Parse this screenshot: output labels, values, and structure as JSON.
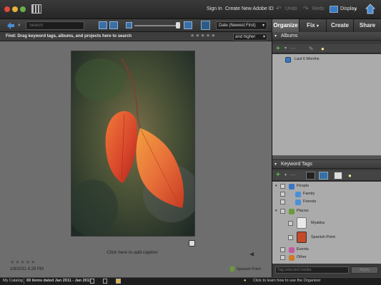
{
  "titlebar": {
    "sign_in": "Sign In",
    "create_id": "Create New Adobe ID",
    "undo": "Undo",
    "redo": "Redo",
    "display": "Display"
  },
  "tabs": [
    {
      "label": "Organize",
      "active": true
    },
    {
      "label": "Fix"
    },
    {
      "label": "Create"
    },
    {
      "label": "Share"
    }
  ],
  "toolbar": {
    "search_placeholder": "Search",
    "sort": "Date (Newest First)"
  },
  "findbar": {
    "text": "Find: Drag keyword tags, albums, and projects here to search",
    "stars": "★★★★★",
    "filter": "and higher"
  },
  "media": {
    "caption": "Click here to add caption",
    "stars": "★★★★★",
    "date": "1/8/2011 4:28 PM",
    "tag": "Spanish Point"
  },
  "albums": {
    "header": "Albums",
    "items": [
      "Last 6 Months"
    ]
  },
  "keyword_tags": {
    "header": "Keyword Tags",
    "items": [
      {
        "label": "People",
        "color": "#3a76c4",
        "level": 0
      },
      {
        "label": "Family",
        "color": "#4a90d8",
        "level": 1
      },
      {
        "label": "Friends",
        "color": "#4a90d8",
        "level": 1
      },
      {
        "label": "Places",
        "color": "#6a9a3a",
        "level": 0
      },
      {
        "label": "Myakka",
        "color": "#dcdcdc",
        "level": 1
      },
      {
        "label": "Spanish Point",
        "color": "#c44a2a",
        "level": 1
      },
      {
        "label": "Events",
        "color": "#c45aa0",
        "level": 0
      },
      {
        "label": "Other",
        "color": "#d07a2a",
        "level": 0
      }
    ],
    "search_placeholder": "Tag selected media",
    "apply": "Apply"
  },
  "status": {
    "catalog": "My Catalog",
    "items": "69 items dated Jan 2011 - Jan 2011",
    "hint": "Click to learn how to use the Organizer"
  }
}
